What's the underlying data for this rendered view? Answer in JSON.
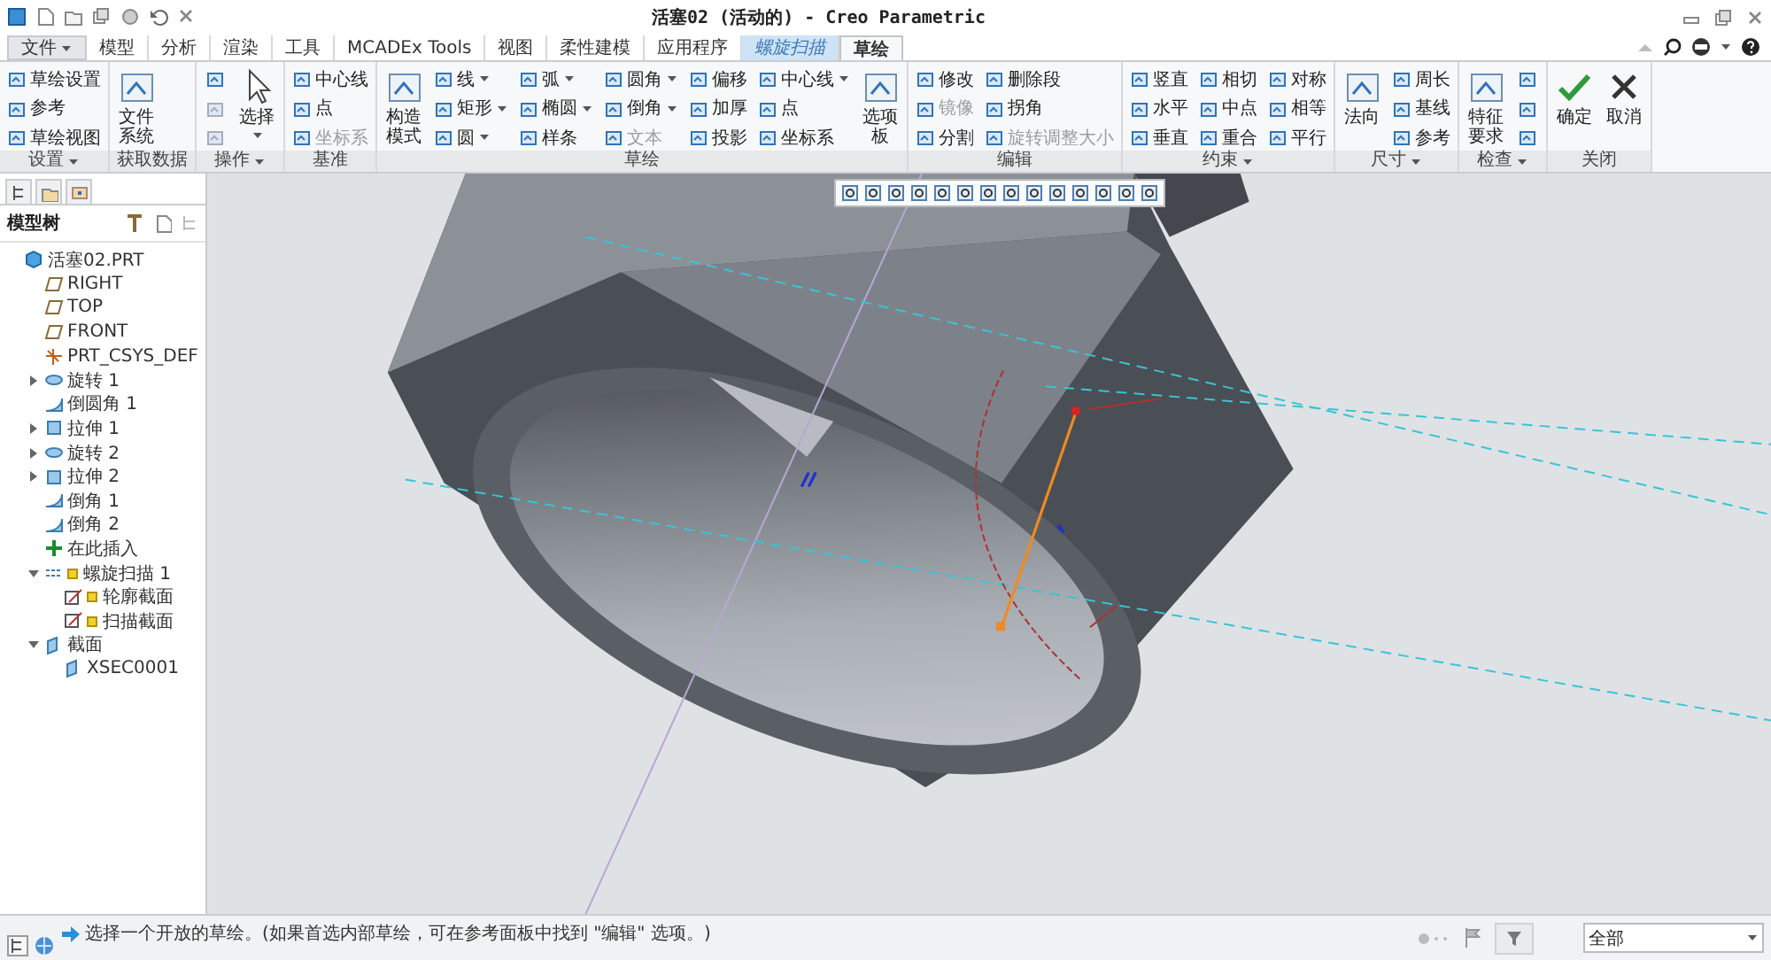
{
  "window": {
    "title": "活塞02 (活动的) - Creo Parametric"
  },
  "menu_tabs": [
    {
      "label": "文件",
      "kind": "file",
      "selected": false
    },
    {
      "label": "模型",
      "kind": "normal",
      "selected": false
    },
    {
      "label": "分析",
      "kind": "normal",
      "selected": false
    },
    {
      "label": "渲染",
      "kind": "normal",
      "selected": false
    },
    {
      "label": "工具",
      "kind": "normal",
      "selected": false
    },
    {
      "label": "MCADEx Tools",
      "kind": "normal",
      "selected": false
    },
    {
      "label": "视图",
      "kind": "normal",
      "selected": false
    },
    {
      "label": "柔性建模",
      "kind": "normal",
      "selected": false
    },
    {
      "label": "应用程序",
      "kind": "normal",
      "selected": false
    },
    {
      "label": "螺旋扫描",
      "kind": "contextual",
      "selected": false
    },
    {
      "label": "草绘",
      "kind": "normal",
      "selected": true
    }
  ],
  "ribbon": {
    "groups": [
      {
        "label": "设置",
        "menu": true,
        "columns": [
          [
            {
              "label": "草绘设置",
              "kind": "small",
              "disabled": false
            },
            {
              "label": "参考",
              "kind": "small",
              "disabled": false
            },
            {
              "label": "草绘视图",
              "kind": "small",
              "disabled": false
            }
          ]
        ]
      },
      {
        "label": "获取数据",
        "columns": [
          [
            {
              "label": "文件系统",
              "kind": "large",
              "disabled": false
            }
          ]
        ]
      },
      {
        "label": "操作",
        "menu": true,
        "columns": [
          [
            {
              "kind": "icon",
              "disabled": false
            },
            {
              "kind": "icon",
              "disabled": true
            },
            {
              "kind": "icon",
              "disabled": true
            }
          ],
          [
            {
              "label": "选择",
              "kind": "large",
              "menu": true,
              "disabled": false
            }
          ]
        ]
      },
      {
        "label": "基准",
        "columns": [
          [
            {
              "label": "中心线",
              "kind": "small",
              "disabled": false
            },
            {
              "label": "点",
              "kind": "small",
              "disabled": false
            },
            {
              "label": "坐标系",
              "kind": "small",
              "disabled": true
            }
          ]
        ]
      },
      {
        "label": "草绘",
        "columns": [
          [
            {
              "label": "构造模式",
              "kind": "large",
              "disabled": false
            }
          ],
          [
            {
              "label": "线",
              "kind": "small",
              "menu": true,
              "disabled": false
            },
            {
              "label": "矩形",
              "kind": "small",
              "menu": true,
              "disabled": false
            },
            {
              "label": "圆",
              "kind": "small",
              "menu": true,
              "disabled": false
            }
          ],
          [
            {
              "label": "弧",
              "kind": "small",
              "menu": true,
              "disabled": false
            },
            {
              "label": "椭圆",
              "kind": "small",
              "menu": true,
              "disabled": false
            },
            {
              "label": "样条",
              "kind": "small",
              "disabled": false
            }
          ],
          [
            {
              "label": "圆角",
              "kind": "small",
              "menu": true,
              "disabled": false
            },
            {
              "label": "倒角",
              "kind": "small",
              "menu": true,
              "disabled": false
            },
            {
              "label": "文本",
              "kind": "small",
              "disabled": true
            }
          ],
          [
            {
              "label": "偏移",
              "kind": "small",
              "disabled": false
            },
            {
              "label": "加厚",
              "kind": "small",
              "disabled": false
            },
            {
              "label": "投影",
              "kind": "small",
              "disabled": false
            }
          ],
          [
            {
              "label": "中心线",
              "kind": "small",
              "menu": true,
              "disabled": false
            },
            {
              "label": "点",
              "kind": "small",
              "disabled": false
            },
            {
              "label": "坐标系",
              "kind": "small",
              "disabled": false
            }
          ],
          [
            {
              "label": "选项板",
              "kind": "large",
              "disabled": false
            }
          ]
        ]
      },
      {
        "label": "编辑",
        "columns": [
          [
            {
              "label": "修改",
              "kind": "small",
              "disabled": false
            },
            {
              "label": "镜像",
              "kind": "small",
              "disabled": true
            },
            {
              "label": "分割",
              "kind": "small",
              "disabled": false
            }
          ],
          [
            {
              "label": "删除段",
              "kind": "small",
              "disabled": false
            },
            {
              "label": "拐角",
              "kind": "small",
              "disabled": false
            },
            {
              "label": "旋转调整大小",
              "kind": "small",
              "disabled": true
            }
          ]
        ]
      },
      {
        "label": "约束",
        "menu": true,
        "columns": [
          [
            {
              "label": "竖直",
              "kind": "small",
              "disabled": false
            },
            {
              "label": "水平",
              "kind": "small",
              "disabled": false
            },
            {
              "label": "垂直",
              "kind": "small",
              "disabled": false
            }
          ],
          [
            {
              "label": "相切",
              "kind": "small",
              "disabled": false
            },
            {
              "label": "中点",
              "kind": "small",
              "disabled": false
            },
            {
              "label": "重合",
              "kind": "small",
              "disabled": false
            }
          ],
          [
            {
              "label": "对称",
              "kind": "small",
              "disabled": false
            },
            {
              "label": "相等",
              "kind": "small",
              "disabled": false
            },
            {
              "label": "平行",
              "kind": "small",
              "disabled": false
            }
          ]
        ]
      },
      {
        "label": "尺寸",
        "menu": true,
        "columns": [
          [
            {
              "label": "法向",
              "kind": "large",
              "disabled": false
            }
          ],
          [
            {
              "label": "周长",
              "kind": "small",
              "disabled": false
            },
            {
              "label": "基线",
              "kind": "small",
              "disabled": false
            },
            {
              "label": "参考",
              "kind": "small",
              "disabled": false
            }
          ]
        ]
      },
      {
        "label": "检查",
        "menu": true,
        "columns": [
          [
            {
              "label": "特征要求",
              "kind": "large",
              "disabled": false
            }
          ],
          [
            {
              "kind": "icon",
              "disabled": false
            },
            {
              "kind": "icon",
              "disabled": false
            },
            {
              "kind": "icon",
              "disabled": false
            }
          ]
        ]
      },
      {
        "label": "关闭",
        "columns": [
          [
            {
              "label": "确定",
              "kind": "confirm",
              "disabled": false
            }
          ],
          [
            {
              "label": "取消",
              "kind": "cancel",
              "disabled": false
            }
          ]
        ]
      }
    ]
  },
  "model_tree": {
    "title": "模型树",
    "items": [
      {
        "label": "活塞02.PRT",
        "kind": "part",
        "children": [
          {
            "label": "RIGHT",
            "kind": "plane"
          },
          {
            "label": "TOP",
            "kind": "plane"
          },
          {
            "label": "FRONT",
            "kind": "plane"
          },
          {
            "label": "PRT_CSYS_DEF",
            "kind": "csys"
          },
          {
            "label": "旋转 1",
            "kind": "revolve",
            "expanded": false
          },
          {
            "label": "倒圆角 1",
            "kind": "round"
          },
          {
            "label": "拉伸 1",
            "kind": "extrude",
            "expanded": false
          },
          {
            "label": "旋转 2",
            "kind": "revolve",
            "expanded": false
          },
          {
            "label": "拉伸 2",
            "kind": "extrude",
            "expanded": false
          },
          {
            "label": "倒角 1",
            "kind": "round"
          },
          {
            "label": "倒角 2",
            "kind": "round"
          },
          {
            "label": "在此插入",
            "kind": "insert"
          },
          {
            "label": "螺旋扫描 1",
            "kind": "sweep",
            "expanded": true,
            "marked": true,
            "children": [
              {
                "label": "轮廓截面",
                "kind": "sketch",
                "marked": true
              },
              {
                "label": "扫描截面",
                "kind": "sketch",
                "marked": true
              }
            ]
          },
          {
            "label": "截面",
            "kind": "section",
            "expanded": true,
            "children": [
              {
                "label": "XSEC0001",
                "kind": "section"
              }
            ]
          }
        ]
      }
    ]
  },
  "status_bar": {
    "message": "选择一个开放的草绘。(如果首选内部草绘，可在参考面板中找到 \"编辑\" 选项。)",
    "filter": "全部"
  }
}
